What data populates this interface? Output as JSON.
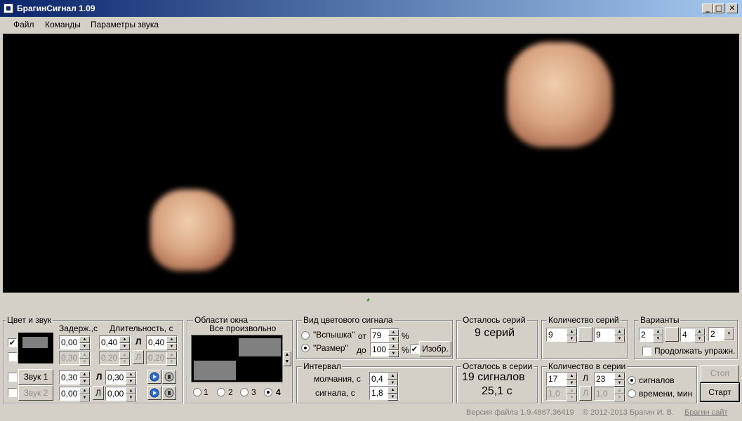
{
  "window": {
    "title": "БрагинСигнал 1.09",
    "minimize": "_",
    "maximize": "□",
    "close": "✕"
  },
  "menu": [
    "Файл",
    "Команды",
    "Параметры звука"
  ],
  "color_sound": {
    "legend": "Цвет и звук",
    "delay_header": "Задерж.,с",
    "duration_header": "Длительность, с",
    "color1_checked": "✔",
    "color1_delay": "0,00",
    "color1_dur1": "0,40",
    "color1_link": "Л",
    "color1_dur2": "0,40",
    "color2_delay": "0,30",
    "color2_dur1": "0,20",
    "color2_link": "Л",
    "color2_dur2": "0,20",
    "sound1_btn": "Звук 1",
    "sound1_delay": "0,30",
    "sound1_link": "Л",
    "sound1_dur": "0,30",
    "sound2_btn": "Звук 2",
    "sound2_delay": "0,00",
    "sound2_link": "Л",
    "sound2_dur": "0,00"
  },
  "window_areas": {
    "legend": "Области окна",
    "subtitle": "Все произвольно",
    "radios": [
      "1",
      "2",
      "3",
      "4"
    ]
  },
  "signal_view": {
    "legend": "Вид цветового сигнала",
    "flash": "\"Вспышка\"",
    "size": "\"Размер\"",
    "from": "от",
    "to": "до",
    "from_val": "79",
    "to_val": "100",
    "pct": "%",
    "image_btn": "Изобр.",
    "image_checked": "✔"
  },
  "interval": {
    "legend": "Интервал",
    "silence_label": "молчания, с",
    "silence_val": "0,4",
    "signal_label": "сигнала, с",
    "signal_val": "1,8"
  },
  "series_left": {
    "legend": "Осталось серий",
    "value": "9 серий"
  },
  "series_count": {
    "legend": "Количество серий",
    "v1": "9",
    "v2": "9"
  },
  "in_series_left": {
    "legend": "Осталось в серии",
    "signals": "19 сигналов",
    "time": "25,1 с"
  },
  "in_series_count": {
    "legend": "Количество в серии",
    "v1": "17",
    "link": "Л",
    "v2": "23",
    "v3": "1,0",
    "link2": "Л",
    "v4": "1,0",
    "opt_signals": "сигналов",
    "opt_time": "времени, мин"
  },
  "variants": {
    "legend": "Варианты",
    "v1": "2",
    "v2": "4",
    "select": "2",
    "continue_label": "Продолжать упражн."
  },
  "buttons": {
    "stop": "Стоп",
    "start": "Старт"
  },
  "status": {
    "version": "Версия файла 1.9.4867.36419",
    "copyright": "©  2012-2013  Брагин И. В.",
    "site": "Брагин сайт"
  },
  "indicator": "*",
  "colors": {
    "titlebar": "#0a246a",
    "face": "#d4d0c8",
    "video_bg": "#000000",
    "swatch_gray": "#808080",
    "link": "#0000ff"
  }
}
